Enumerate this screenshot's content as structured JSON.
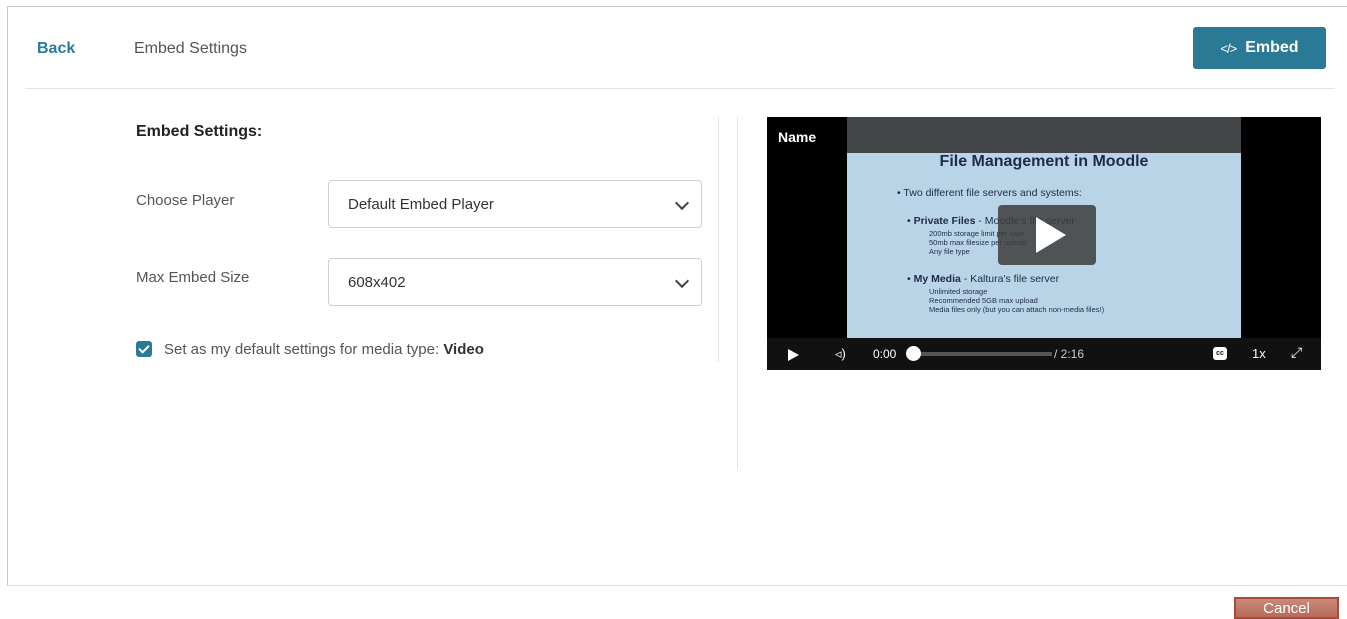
{
  "header": {
    "back_label": "Back",
    "title": "Embed Settings",
    "embed_button_icon": "</>",
    "embed_button_label": "Embed"
  },
  "settings": {
    "heading": "Embed Settings:",
    "choose_player_label": "Choose Player",
    "choose_player_value": "Default Embed Player",
    "max_size_label": "Max Embed Size",
    "max_size_value": "608x402",
    "default_checkbox_checked": true,
    "default_label_prefix": "Set as my default settings for media type: ",
    "default_media_type": "Video"
  },
  "player": {
    "name": "Name",
    "slide": {
      "title": "File Management in Moodle",
      "bullet1": "• Two different file servers and systems:",
      "bullet2_bold": "Private Files",
      "bullet2_rest": " - Moodle's file server",
      "bullet2_subs": [
        "200mb storage limit per user",
        "50mb max filesize per upload",
        "Any file type"
      ],
      "bullet3_bold": "My Media",
      "bullet3_rest": " - Kaltura's file server",
      "bullet3_subs": [
        "Unlimited storage",
        "Recommended 5GB max upload",
        "Media files only (but you can attach non-media files!)"
      ]
    },
    "current_time": "0:00",
    "duration": "/ 2:16",
    "cc_label": "cc",
    "speed": "1x",
    "progress_fraction": 0
  },
  "footer": {
    "cancel_label": "Cancel"
  },
  "icons": {
    "volume": "volume-icon",
    "fullscreen": "fullscreen-icon",
    "chevron": "chevron-down-icon"
  },
  "colors": {
    "accent": "#2a7a96",
    "link": "#2a7a9c",
    "cancel": "#b86b5a"
  }
}
